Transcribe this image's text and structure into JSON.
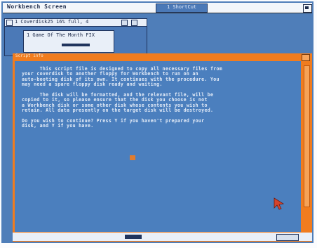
{
  "screen": {
    "title": "Workbench Screen",
    "memory_text": "1 ShortCut"
  },
  "drawer_window": {
    "title": "1 Coverdisk25  16% full, 4",
    "icon_label": "1 Game Of The Month FIX"
  },
  "script_window": {
    "title": "Script info",
    "text": "      This script file is designed to copy all necessary files from\nyour coverdisk to another floppy for Workbench to run on an\nauto-booting disk of its own. It continues with the procedure. You\nmay need a spare floppy disk ready and waiting.\n\n      The disk will be formatted, and the relevant file, will be\ncopied to it, so please ensure that the disk you choose is not\na Workbench disk or some other disk whose contents you wish to\nretain. All data presently on the target disk will be destroyed.\n\nDo you wish to continue? Press Y if you haven't prepared your\ndisk, and Y if you have.",
    "cursor_color": "#f07c1f"
  },
  "colors": {
    "desktop": "#4f7eb9",
    "window_frame": "#f07c1f",
    "window_body": "#4b7fbe",
    "text": "#e4ecf8",
    "titlebar": "#f3f6fa"
  },
  "icons": [
    "close-icon",
    "depth-icon",
    "mouse-pointer-icon",
    "scroll-arrow-icon"
  ]
}
